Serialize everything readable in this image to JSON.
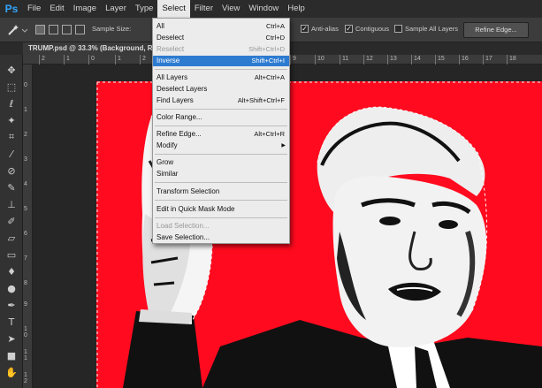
{
  "app": {
    "logo": "Ps"
  },
  "menubar": {
    "items": [
      "File",
      "Edit",
      "Image",
      "Layer",
      "Type",
      "Select",
      "Filter",
      "View",
      "Window",
      "Help"
    ],
    "active": "Select"
  },
  "options": {
    "sample_size_label": "Sample Size:",
    "anti_alias": "Anti-alias",
    "contiguous": "Contiguous",
    "sample_all_layers": "Sample All Layers",
    "refine_edge": "Refine Edge..."
  },
  "document": {
    "tab_title": "TRUMP.psd @ 33.3% (Background, RG"
  },
  "ruler": {
    "top": [
      "2",
      "1",
      "0",
      "1",
      "2",
      "9",
      "10",
      "11",
      "12",
      "13",
      "14",
      "15",
      "16",
      "17",
      "18"
    ],
    "left": [
      "0",
      "1",
      "2",
      "3",
      "4",
      "5",
      "6",
      "7",
      "8",
      "9",
      "1\n0",
      "1\n1",
      "1\n2"
    ]
  },
  "select_menu": {
    "items": [
      {
        "label": "All",
        "shortcut": "Ctrl+A"
      },
      {
        "label": "Deselect",
        "shortcut": "Ctrl+D"
      },
      {
        "label": "Reselect",
        "shortcut": "Shift+Ctrl+D",
        "disabled": true
      },
      {
        "label": "Inverse",
        "shortcut": "Shift+Ctrl+I",
        "highlighted": true
      },
      {
        "label": "All Layers",
        "shortcut": "Alt+Ctrl+A"
      },
      {
        "label": "Deselect Layers",
        "shortcut": ""
      },
      {
        "label": "Find Layers",
        "shortcut": "Alt+Shift+Ctrl+F"
      },
      {
        "label": "Color Range...",
        "shortcut": ""
      },
      {
        "label": "Refine Edge...",
        "shortcut": "Alt+Ctrl+R"
      },
      {
        "label": "Modify",
        "shortcut": ""
      },
      {
        "label": "Grow",
        "shortcut": ""
      },
      {
        "label": "Similar",
        "shortcut": ""
      },
      {
        "label": "Transform Selection",
        "shortcut": ""
      },
      {
        "label": "Edit in Quick Mask Mode",
        "shortcut": ""
      },
      {
        "label": "Load Selection...",
        "shortcut": "",
        "disabled": true
      },
      {
        "label": "Save Selection...",
        "shortcut": ""
      }
    ]
  },
  "colors": {
    "canvas_red": "#ff0a1e",
    "highlight": "#2d7bd1",
    "menu_bg": "#ececec"
  },
  "tools": [
    "move-icon",
    "marquee-icon",
    "lasso-icon",
    "magic-wand-icon",
    "crop-icon",
    "eyedropper-icon",
    "healing-icon",
    "brush-icon",
    "stamp-icon",
    "history-brush-icon",
    "eraser-icon",
    "gradient-icon",
    "blur-icon",
    "dodge-icon",
    "pen-icon",
    "type-icon",
    "path-select-icon",
    "shape-icon",
    "hand-icon",
    "zoom-icon"
  ]
}
